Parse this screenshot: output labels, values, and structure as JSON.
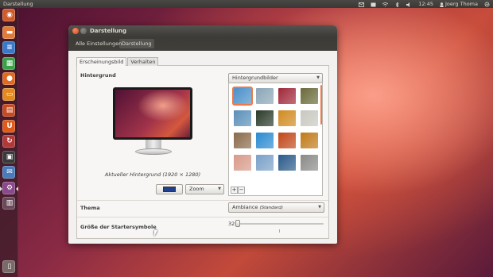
{
  "panel": {
    "app_title": "Darstellung",
    "clock": "12:45",
    "user": "Joerg Thoma"
  },
  "window": {
    "title": "Darstellung",
    "breadcrumbs": [
      "Alle Einstellungen",
      "Darstellung"
    ],
    "tabs": [
      "Erscheinungsbild",
      "Verhalten"
    ],
    "active_tab": "Erscheinungsbild"
  },
  "background": {
    "section_label": "Hintergrund",
    "source_select": "Hintergrundbilder",
    "caption": "Aktueller Hintergrund (1920 × 1280)",
    "color_swatch": "#1f3f8f",
    "zoom_select": "Zoom",
    "add_label": "+",
    "remove_label": "−",
    "thumbnails": [
      "#4a90c9",
      "#8aa6b8",
      "#a0283a",
      "#6a6a3a",
      "#5a8fb8",
      "#2a3a2a",
      "#d08a20",
      "#c8c8c0",
      "#8a6a4a",
      "#2a8ad0",
      "#c0481a",
      "#c07a1a",
      "#d89a8a",
      "#7aa0c8",
      "#2a5a8a",
      "#8a8a88"
    ]
  },
  "theme": {
    "label": "Thema",
    "select_value": "Ambiance",
    "select_suffix": "(Standard)"
  },
  "launcher_size": {
    "label": "Größe der Startersymbole",
    "value": "32"
  },
  "colors": {
    "accent": "#f07746",
    "titlebar": "#3c3b37",
    "window_bg": "#f2f1f0"
  }
}
